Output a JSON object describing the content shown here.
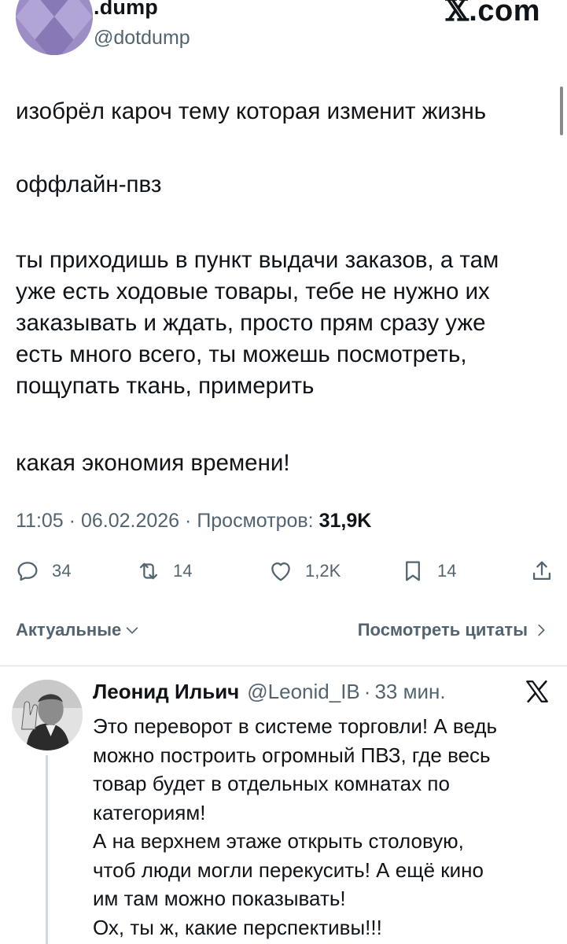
{
  "post": {
    "author": {
      "name": ".dump",
      "handle": "@dotdump"
    },
    "site_badge": ".com",
    "body_lines": [
      "изобрёл кароч тему которая изменит жизнь",
      "оффлайн-пвз",
      "ты приходишь в пункт выдачи заказов, а там",
      "уже есть ходовые товары, тебе не нужно их",
      "заказывать и ждать, просто прям сразу уже",
      "есть много всего, ты можешь посмотреть,",
      "пощупать ткань, примерить",
      "какая экономия времени!"
    ],
    "meta": {
      "time": "11:05",
      "date": "06.02.2026",
      "views_label": "Просмотров:",
      "views_count": "31,9K"
    },
    "actions": {
      "replies": "34",
      "reposts": "14",
      "likes": "1,2K",
      "bookmarks": "14"
    }
  },
  "tabs": {
    "sort_label": "Актуальные",
    "quotes_label": "Посмотреть цитаты"
  },
  "reply": {
    "name": "Леонид Ильич",
    "handle": "@Leonid_IB",
    "time": "33 мин.",
    "body_lines": [
      "Это переворот в системе торговли! А ведь",
      "можно построить огромный ПВЗ, где весь",
      "товар будет в отдельных комнатах по",
      "категориям!",
      "А на верхнем этаже открыть столовую,",
      "чтоб люди могли перекусить! А ещё кино",
      "им там можно показывать!",
      "Ох, ты ж, какие перспективы!!!"
    ]
  },
  "icons": {
    "x_logo": "x-logo-icon",
    "reply": "speech-bubble-icon",
    "repost": "repost-arrows-icon",
    "like": "heart-icon",
    "bookmark": "bookmark-icon",
    "share": "share-upload-icon",
    "chevron_down": "chevron-down-icon",
    "chevron_right": "chevron-right-icon"
  },
  "colors": {
    "text_primary": "#0f1419",
    "text_secondary": "#536471",
    "divider": "#dde1e5",
    "avatar_purple": "#9c8ec4"
  }
}
